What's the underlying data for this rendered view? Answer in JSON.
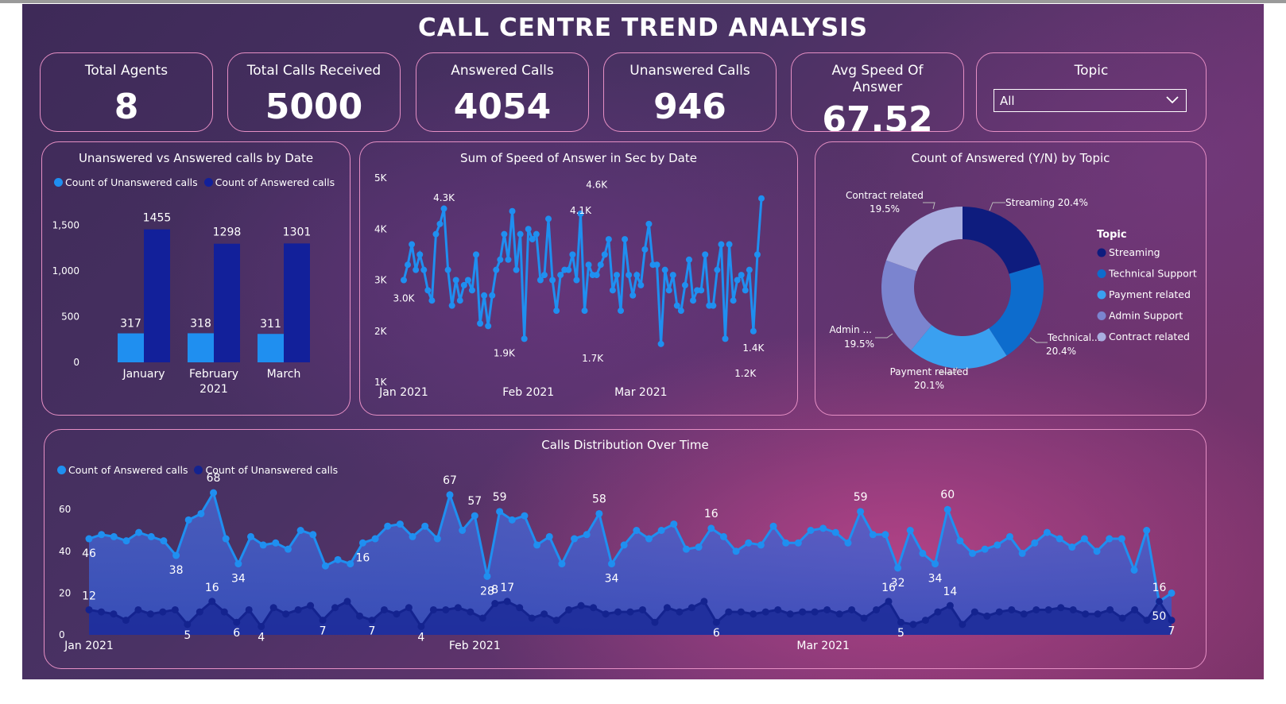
{
  "dashboard": {
    "title": "CALL CENTRE TREND ANALYSIS"
  },
  "kpis": [
    {
      "label": "Total Agents",
      "value": "8"
    },
    {
      "label": "Total Calls Received",
      "value": "5000"
    },
    {
      "label": "Answered Calls",
      "value": "4054"
    },
    {
      "label": "Unanswered Calls",
      "value": "946"
    },
    {
      "label": "Avg Speed Of Answer",
      "value": "67.52"
    }
  ],
  "topic_filter": {
    "label": "Topic",
    "selected": "All"
  },
  "colors": {
    "light_blue": "#1f8ff0",
    "navy": "#12209a",
    "card_border": "#e58fc4"
  },
  "chart_data": [
    {
      "type": "bar",
      "title": "Unanswered vs Answered calls by Date",
      "categories": [
        "January",
        "February",
        "March"
      ],
      "category_sublabel": "2021",
      "series": [
        {
          "name": "Count of Unanswered calls",
          "values": [
            317,
            318,
            311
          ],
          "color": "#1f8ff0"
        },
        {
          "name": "Count of Answered calls",
          "values": [
            1455,
            1298,
            1301
          ],
          "color": "#12209a"
        }
      ],
      "yticks": [
        "0",
        "500",
        "1,000",
        "1,500"
      ],
      "ylim": [
        0,
        1700
      ],
      "legend": "top-left"
    },
    {
      "type": "line",
      "title": "Sum of Speed of Answer in Sec by Date",
      "yticks": [
        "1K",
        "2K",
        "3K",
        "4K",
        "5K"
      ],
      "ylim": [
        1000,
        5000
      ],
      "xticks": [
        {
          "label": "Jan 2021",
          "day": 0
        },
        {
          "label": "Feb 2021",
          "day": 31
        },
        {
          "label": "Mar 2021",
          "day": 59
        }
      ],
      "x_range": [
        0,
        89
      ],
      "values": [
        3000,
        3300,
        3700,
        3200,
        3500,
        3200,
        2800,
        2600,
        3900,
        4100,
        4400,
        3200,
        2500,
        3000,
        2600,
        2900,
        3000,
        2800,
        3500,
        2150,
        2700,
        2100,
        2700,
        3200,
        3400,
        3900,
        3400,
        4350,
        3200,
        3900,
        1850,
        4000,
        3800,
        3900,
        3000,
        3100,
        4200,
        3000,
        2400,
        3100,
        3200,
        3200,
        3500,
        3000,
        4300,
        2400,
        3300,
        3100,
        3100,
        3300,
        3500,
        3800,
        2800,
        3100,
        2400,
        3800,
        3100,
        2700,
        3100,
        2900,
        3600,
        4100,
        3300,
        3300,
        1750,
        3200,
        2800,
        3100,
        2500,
        2400,
        2900,
        3400,
        2600,
        2800,
        2800,
        3500,
        2500,
        2500,
        3200,
        3700,
        1850,
        3700,
        2600,
        3000,
        3100,
        2800,
        3200,
        2000,
        3500,
        4600
      ],
      "annotations": [
        {
          "label": "3.0K",
          "day": 0,
          "value": 3000
        },
        {
          "label": "4.3K",
          "day": 10,
          "value": 4350
        },
        {
          "label": "1.9K",
          "day": 25,
          "value": 1850
        },
        {
          "label": "4.1K",
          "day": 44,
          "value": 4100
        },
        {
          "label": "4.6K",
          "day": 48,
          "value": 4600
        },
        {
          "label": "1.7K",
          "day": 47,
          "value": 1750
        },
        {
          "label": "1.2K",
          "day": 85,
          "value": 1200
        },
        {
          "label": "1.4K",
          "day": 87,
          "value": 1400
        }
      ]
    },
    {
      "type": "pie",
      "title": "Count of Answered (Y/N) by Topic",
      "legend_title": "Topic",
      "slices": [
        {
          "name": "Streaming",
          "value": 20.4,
          "color": "#0e1c7e",
          "label": "Streaming 20.4%"
        },
        {
          "name": "Technical Support",
          "value": 20.4,
          "color": "#0d6ccd",
          "label": "Technical...",
          "pct": "20.4%"
        },
        {
          "name": "Payment related",
          "value": 20.1,
          "color": "#3aa0f0",
          "label": "Payment related",
          "pct": "20.1%"
        },
        {
          "name": "Admin Support",
          "value": 19.5,
          "color": "#7b84cf",
          "label": "Admin ...",
          "pct": "19.5%"
        },
        {
          "name": "Contract related",
          "value": 19.5,
          "color": "#a9aee0",
          "label": "Contract related",
          "pct": "19.5%"
        }
      ],
      "legend": "right"
    },
    {
      "type": "area",
      "title": "Calls Distribution Over Time",
      "series": [
        {
          "name": "Count of Answered calls",
          "color": "#1f8ff0",
          "values": [
            46,
            48,
            47,
            45,
            49,
            47,
            45,
            38,
            55,
            58,
            68,
            46,
            34,
            47,
            43,
            44,
            41,
            50,
            48,
            33,
            36,
            34,
            44,
            46,
            52,
            53,
            47,
            52,
            46,
            67,
            50,
            57,
            28,
            59,
            55,
            57,
            43,
            47,
            34,
            46,
            48,
            58,
            34,
            43,
            50,
            46,
            50,
            53,
            41,
            42,
            51,
            47,
            40,
            44,
            43,
            52,
            44,
            44,
            50,
            51,
            49,
            44,
            59,
            48,
            48,
            32,
            50,
            39,
            34,
            60,
            45,
            39,
            41,
            43,
            47,
            39,
            44,
            49,
            46,
            42,
            46,
            40,
            46,
            46,
            31,
            50,
            16,
            20
          ]
        },
        {
          "name": "Count of Unanswered calls",
          "color": "#14238f",
          "values": [
            12,
            11,
            10,
            7,
            12,
            10,
            11,
            12,
            5,
            11,
            16,
            11,
            6,
            12,
            4,
            13,
            10,
            12,
            14,
            7,
            13,
            16,
            9,
            7,
            12,
            10,
            13,
            4,
            12,
            12,
            13,
            11,
            8,
            15,
            16,
            13,
            8,
            10,
            7,
            12,
            14,
            13,
            10,
            11,
            11,
            12,
            6,
            13,
            11,
            13,
            16,
            6,
            11,
            11,
            10,
            11,
            12,
            10,
            11,
            11,
            12,
            10,
            12,
            8,
            12,
            16,
            6,
            5,
            7,
            11,
            14,
            5,
            11,
            9,
            11,
            12,
            10,
            12,
            12,
            13,
            12,
            10,
            10,
            12,
            8,
            12,
            7,
            16,
            7
          ]
        }
      ],
      "yticks": [
        "0",
        "20",
        "40",
        "60"
      ],
      "ylim": [
        0,
        75
      ],
      "xticks": [
        {
          "label": "Jan 2021",
          "day": 0
        },
        {
          "label": "Feb 2021",
          "day": 31
        },
        {
          "label": "Mar 2021",
          "day": 59
        }
      ],
      "answered_labels": [
        {
          "i": 0,
          "t": "46"
        },
        {
          "i": 7,
          "t": "38"
        },
        {
          "i": 10,
          "t": "68"
        },
        {
          "i": 12,
          "t": "34"
        },
        {
          "i": 22,
          "t": "16"
        },
        {
          "i": 29,
          "t": "67"
        },
        {
          "i": 31,
          "t": "57"
        },
        {
          "i": 32,
          "t": "28"
        },
        {
          "i": 33,
          "t": "59"
        },
        {
          "i": 41,
          "t": "58"
        },
        {
          "i": 42,
          "t": "34"
        },
        {
          "i": 50,
          "t": "16"
        },
        {
          "i": 62,
          "t": "59"
        },
        {
          "i": 65,
          "t": "32"
        },
        {
          "i": 68,
          "t": "34"
        },
        {
          "i": 69,
          "t": "60"
        },
        {
          "i": 86,
          "t": "50"
        },
        {
          "i": 88,
          "t": "20"
        }
      ],
      "unanswered_labels": [
        {
          "i": 0,
          "t": "12"
        },
        {
          "i": 8,
          "t": "5"
        },
        {
          "i": 10,
          "t": "16"
        },
        {
          "i": 12,
          "t": "6"
        },
        {
          "i": 14,
          "t": "4"
        },
        {
          "i": 19,
          "t": "7"
        },
        {
          "i": 23,
          "t": "7"
        },
        {
          "i": 27,
          "t": "4"
        },
        {
          "i": 34,
          "t": "17"
        },
        {
          "i": 33,
          "t": "8"
        },
        {
          "i": 51,
          "t": "6"
        },
        {
          "i": 65,
          "t": "16"
        },
        {
          "i": 66,
          "t": "5"
        },
        {
          "i": 70,
          "t": "14"
        },
        {
          "i": 87,
          "t": "16"
        },
        {
          "i": 88,
          "t": "7"
        }
      ],
      "legend": "top-left"
    }
  ]
}
